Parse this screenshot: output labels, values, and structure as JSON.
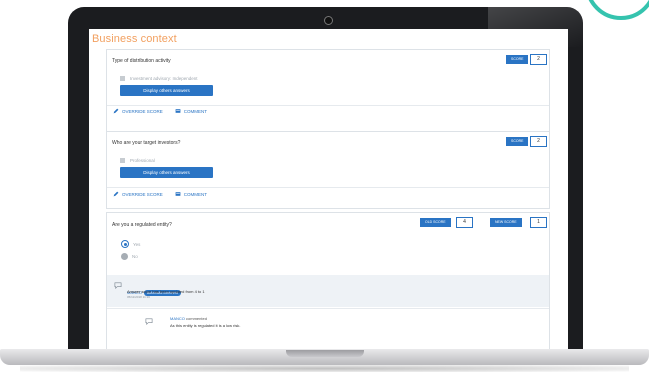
{
  "page": {
    "title": "Business context"
  },
  "questions": [
    {
      "text": "Type of distribution activity",
      "score_label": "SCORE",
      "score_value": "2",
      "option": "Investment advisory: Independent",
      "display_btn": "Display others answers",
      "override_label": "OVERRIDE SCORE",
      "comment_label": "COMMENT"
    },
    {
      "text": "Who are your target investors?",
      "score_label": "SCORE",
      "score_value": "2",
      "option": "Professional",
      "display_btn": "Display others answers",
      "override_label": "OVERRIDE SCORE",
      "comment_label": "COMMENT"
    },
    {
      "text": "Are you a regulated entity?",
      "old_score_label": "OLD SCORE",
      "old_score_value": "4",
      "new_score_label": "NEW SCORE",
      "new_score_value": "1",
      "options": [
        "Yes",
        "No"
      ],
      "comments": [
        {
          "author": "MANCO",
          "badge": "Automatic comment",
          "text": "Answer score has been updated from 4 to 1",
          "date": "05/11/2018 11:16"
        },
        {
          "author": "MANCO",
          "action": "commented",
          "text": "As this entity is regulated it is a low risk."
        }
      ]
    }
  ],
  "icons": {
    "pencil": "pencil-icon",
    "comment": "comment-icon",
    "bubble": "speech-bubble-icon"
  },
  "colors": {
    "title_orange": "#f2a060",
    "primary_blue": "#2a74c4",
    "teal_ring": "#35c3ae"
  }
}
